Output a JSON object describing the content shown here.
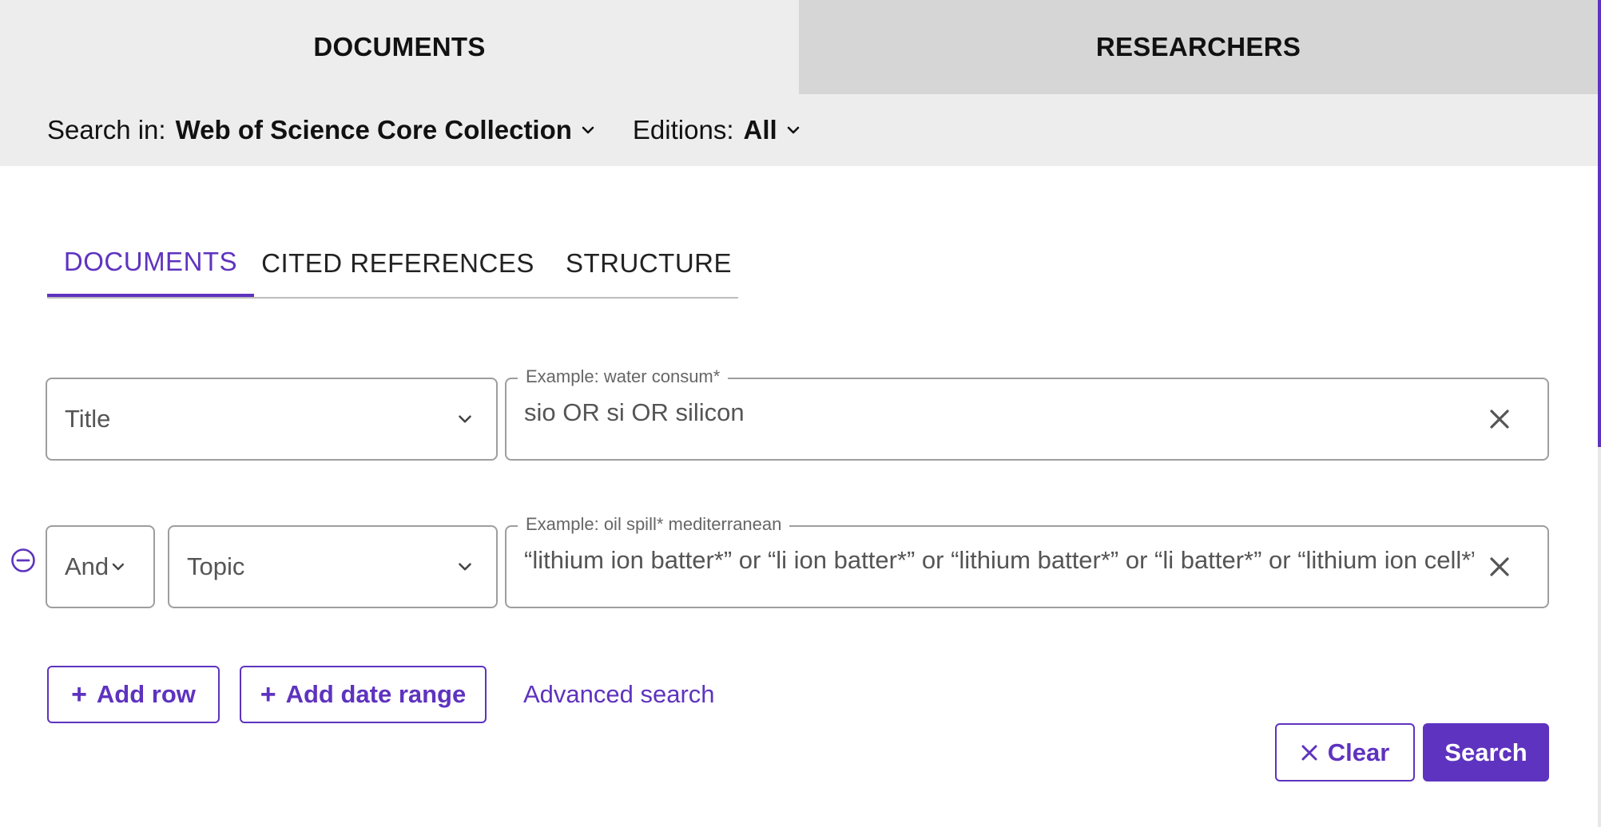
{
  "top_tabs": {
    "documents": "DOCUMENTS",
    "researchers": "RESEARCHERS"
  },
  "scope": {
    "search_in_label": "Search in:",
    "search_in_value": "Web of Science Core Collection",
    "editions_label": "Editions:",
    "editions_value": "All"
  },
  "inner_tabs": [
    "DOCUMENTS",
    "CITED REFERENCES",
    "STRUCTURE"
  ],
  "rows": [
    {
      "field": "Title",
      "example": "Example: water consum*",
      "value": "sio OR si OR silicon"
    },
    {
      "operator": "And",
      "field": "Topic",
      "example": "Example: oil spill* mediterranean",
      "value": "“lithium ion batter*” or “li ion batter*” or “lithium batter*” or “li batter*” or “lithium ion cell*”"
    }
  ],
  "actions": {
    "add_row": "Add row",
    "add_date_range": "Add date range",
    "advanced_search": "Advanced search",
    "clear": "Clear",
    "search": "Search"
  },
  "colors": {
    "accent": "#5e33bf",
    "band": "#ededed",
    "inactive_tab": "#d6d6d6"
  },
  "icons": [
    "chevron-down-icon",
    "close-icon",
    "remove-row-icon",
    "plus-icon"
  ]
}
